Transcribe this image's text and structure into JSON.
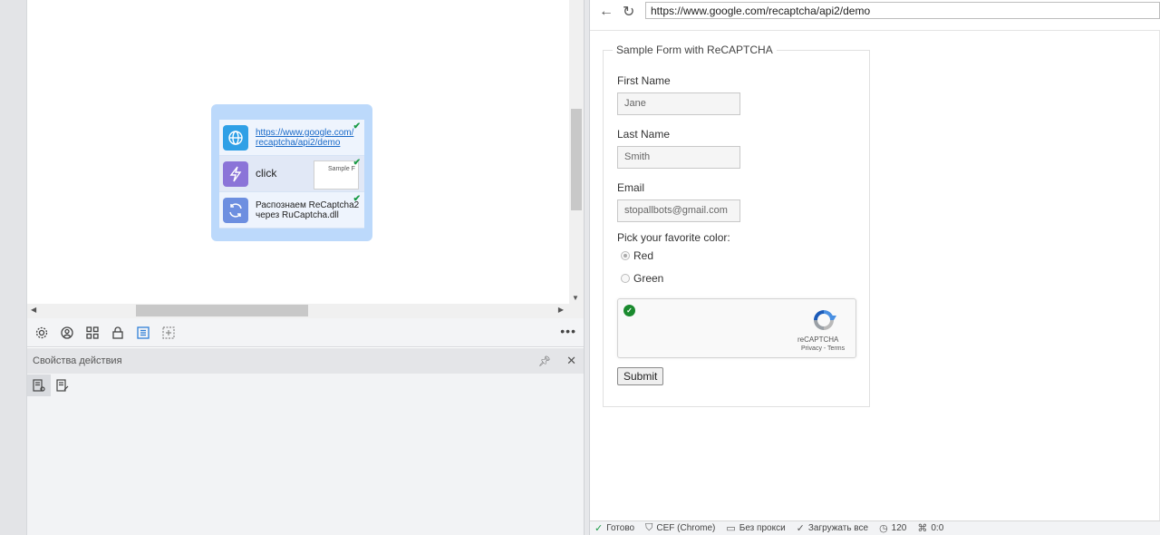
{
  "editor": {
    "nodes": [
      {
        "text_line1": "https://www.google.com/",
        "text_line2": "recaptcha/api2/demo",
        "icon": "globe-icon"
      },
      {
        "text": "click",
        "thumb_text": "Sample F",
        "icon": "lightning-icon"
      },
      {
        "text_line1": "Распознаем ReCaptcha2",
        "text_line2": "через RuCaptcha.dll",
        "icon": "refresh-icon"
      }
    ],
    "toolbar_icons": [
      "settings-icon",
      "user-icon",
      "grid-icon",
      "lock-icon",
      "list-icon",
      "add-box-icon"
    ]
  },
  "properties_panel": {
    "title": "Свойства действия"
  },
  "browser": {
    "url": "https://www.google.com/recaptcha/api2/demo",
    "form": {
      "legend": "Sample Form with ReCAPTCHA",
      "first_name_label": "First Name",
      "first_name_value": "Jane",
      "last_name_label": "Last Name",
      "last_name_value": "Smith",
      "email_label": "Email",
      "email_value": "stopallbots@gmail.com",
      "color_label": "Pick your favorite color:",
      "color_options": [
        "Red",
        "Green"
      ],
      "selected_color": "Red",
      "captcha_brand": "reCAPTCHA",
      "captcha_links": "Privacy - Terms",
      "submit_label": "Submit"
    }
  },
  "status_bar": {
    "ready": "Готово",
    "engine": "CEF (Chrome)",
    "proxy": "Без прокси",
    "load": "Загружать все",
    "timeout": "120",
    "counter": "0:0"
  },
  "colors": {
    "group_bg": "#bcd9fb",
    "link": "#1a6ac8",
    "check_green": "#1b9b47"
  }
}
